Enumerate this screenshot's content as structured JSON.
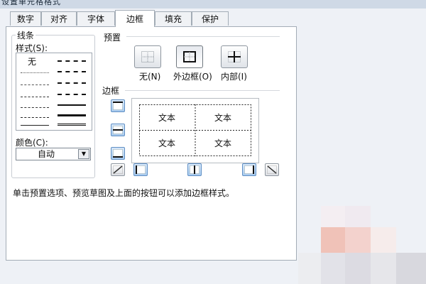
{
  "window": {
    "title": "设置单元格格式"
  },
  "tabs": [
    "数字",
    "对齐",
    "字体",
    "边框",
    "填充",
    "保护"
  ],
  "active_tab": "边框",
  "line_section": {
    "title": "线条",
    "style_label": "样式(S):",
    "none_label": "无",
    "color_label": "颜色(C):",
    "color_value": "自动"
  },
  "presets": {
    "title": "预置",
    "items": [
      {
        "label": "无(N)",
        "icon": "preset-none-icon"
      },
      {
        "label": "外边框(O)",
        "icon": "preset-outline-icon"
      },
      {
        "label": "内部(I)",
        "icon": "preset-inside-icon"
      }
    ]
  },
  "border": {
    "title": "边框",
    "cell_texts": [
      "文本",
      "文本",
      "文本",
      "文本"
    ]
  },
  "description": "单击预置选项、预览草图及上面的按钮可以添加边框样式。",
  "colors": {
    "accent_blue": "#5f8fc4",
    "tab_border": "#a3acb6"
  }
}
